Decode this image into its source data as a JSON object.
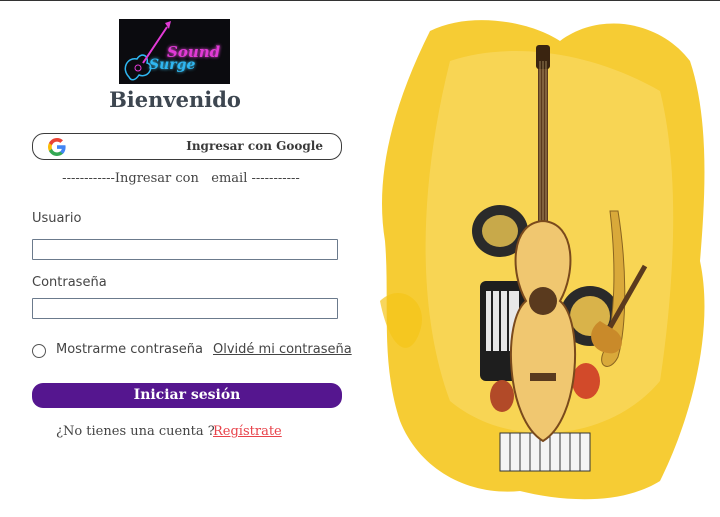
{
  "logo": {
    "line1": "Sound",
    "line2": "Surge",
    "colors": {
      "bg": "#0b0b0f",
      "pink": "#e23ad6",
      "blue": "#2fb7f2"
    }
  },
  "header": {
    "title": "Bienvenido"
  },
  "google": {
    "label": "Ingresar con Google",
    "icon": "google-icon"
  },
  "divider": {
    "text": "------------Ingresar con   email -----------"
  },
  "form": {
    "username_label": "Usuario",
    "username_value": "",
    "password_label": "Contraseña",
    "password_value": "",
    "show_password_label": "Mostrarme contraseña",
    "forgot_label": "Olvidé mi contraseña",
    "submit_label": "Iniciar sesión"
  },
  "signup": {
    "prompt": "¿No tienes una cuenta ?",
    "link_label": "Regístrate"
  },
  "theme": {
    "accent": "#55168f",
    "link_red": "#e8424a",
    "art_yellow": "#f5c518"
  }
}
